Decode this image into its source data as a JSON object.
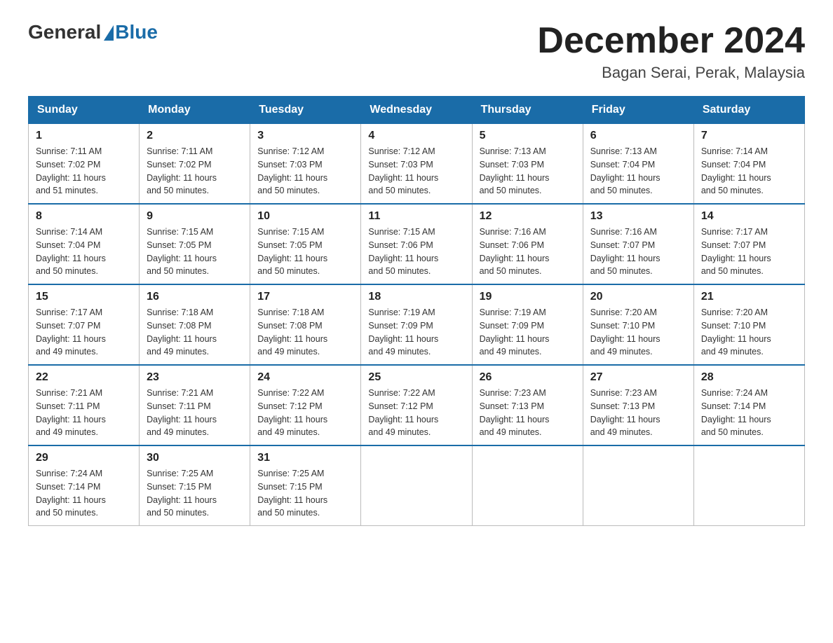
{
  "header": {
    "logo_general": "General",
    "logo_blue": "Blue",
    "month_title": "December 2024",
    "location": "Bagan Serai, Perak, Malaysia"
  },
  "days_of_week": [
    "Sunday",
    "Monday",
    "Tuesday",
    "Wednesday",
    "Thursday",
    "Friday",
    "Saturday"
  ],
  "weeks": [
    [
      {
        "day": "1",
        "sunrise": "7:11 AM",
        "sunset": "7:02 PM",
        "daylight": "11 hours and 51 minutes."
      },
      {
        "day": "2",
        "sunrise": "7:11 AM",
        "sunset": "7:02 PM",
        "daylight": "11 hours and 50 minutes."
      },
      {
        "day": "3",
        "sunrise": "7:12 AM",
        "sunset": "7:03 PM",
        "daylight": "11 hours and 50 minutes."
      },
      {
        "day": "4",
        "sunrise": "7:12 AM",
        "sunset": "7:03 PM",
        "daylight": "11 hours and 50 minutes."
      },
      {
        "day": "5",
        "sunrise": "7:13 AM",
        "sunset": "7:03 PM",
        "daylight": "11 hours and 50 minutes."
      },
      {
        "day": "6",
        "sunrise": "7:13 AM",
        "sunset": "7:04 PM",
        "daylight": "11 hours and 50 minutes."
      },
      {
        "day": "7",
        "sunrise": "7:14 AM",
        "sunset": "7:04 PM",
        "daylight": "11 hours and 50 minutes."
      }
    ],
    [
      {
        "day": "8",
        "sunrise": "7:14 AM",
        "sunset": "7:04 PM",
        "daylight": "11 hours and 50 minutes."
      },
      {
        "day": "9",
        "sunrise": "7:15 AM",
        "sunset": "7:05 PM",
        "daylight": "11 hours and 50 minutes."
      },
      {
        "day": "10",
        "sunrise": "7:15 AM",
        "sunset": "7:05 PM",
        "daylight": "11 hours and 50 minutes."
      },
      {
        "day": "11",
        "sunrise": "7:15 AM",
        "sunset": "7:06 PM",
        "daylight": "11 hours and 50 minutes."
      },
      {
        "day": "12",
        "sunrise": "7:16 AM",
        "sunset": "7:06 PM",
        "daylight": "11 hours and 50 minutes."
      },
      {
        "day": "13",
        "sunrise": "7:16 AM",
        "sunset": "7:07 PM",
        "daylight": "11 hours and 50 minutes."
      },
      {
        "day": "14",
        "sunrise": "7:17 AM",
        "sunset": "7:07 PM",
        "daylight": "11 hours and 50 minutes."
      }
    ],
    [
      {
        "day": "15",
        "sunrise": "7:17 AM",
        "sunset": "7:07 PM",
        "daylight": "11 hours and 49 minutes."
      },
      {
        "day": "16",
        "sunrise": "7:18 AM",
        "sunset": "7:08 PM",
        "daylight": "11 hours and 49 minutes."
      },
      {
        "day": "17",
        "sunrise": "7:18 AM",
        "sunset": "7:08 PM",
        "daylight": "11 hours and 49 minutes."
      },
      {
        "day": "18",
        "sunrise": "7:19 AM",
        "sunset": "7:09 PM",
        "daylight": "11 hours and 49 minutes."
      },
      {
        "day": "19",
        "sunrise": "7:19 AM",
        "sunset": "7:09 PM",
        "daylight": "11 hours and 49 minutes."
      },
      {
        "day": "20",
        "sunrise": "7:20 AM",
        "sunset": "7:10 PM",
        "daylight": "11 hours and 49 minutes."
      },
      {
        "day": "21",
        "sunrise": "7:20 AM",
        "sunset": "7:10 PM",
        "daylight": "11 hours and 49 minutes."
      }
    ],
    [
      {
        "day": "22",
        "sunrise": "7:21 AM",
        "sunset": "7:11 PM",
        "daylight": "11 hours and 49 minutes."
      },
      {
        "day": "23",
        "sunrise": "7:21 AM",
        "sunset": "7:11 PM",
        "daylight": "11 hours and 49 minutes."
      },
      {
        "day": "24",
        "sunrise": "7:22 AM",
        "sunset": "7:12 PM",
        "daylight": "11 hours and 49 minutes."
      },
      {
        "day": "25",
        "sunrise": "7:22 AM",
        "sunset": "7:12 PM",
        "daylight": "11 hours and 49 minutes."
      },
      {
        "day": "26",
        "sunrise": "7:23 AM",
        "sunset": "7:13 PM",
        "daylight": "11 hours and 49 minutes."
      },
      {
        "day": "27",
        "sunrise": "7:23 AM",
        "sunset": "7:13 PM",
        "daylight": "11 hours and 49 minutes."
      },
      {
        "day": "28",
        "sunrise": "7:24 AM",
        "sunset": "7:14 PM",
        "daylight": "11 hours and 50 minutes."
      }
    ],
    [
      {
        "day": "29",
        "sunrise": "7:24 AM",
        "sunset": "7:14 PM",
        "daylight": "11 hours and 50 minutes."
      },
      {
        "day": "30",
        "sunrise": "7:25 AM",
        "sunset": "7:15 PM",
        "daylight": "11 hours and 50 minutes."
      },
      {
        "day": "31",
        "sunrise": "7:25 AM",
        "sunset": "7:15 PM",
        "daylight": "11 hours and 50 minutes."
      },
      null,
      null,
      null,
      null
    ]
  ],
  "labels": {
    "sunrise": "Sunrise:",
    "sunset": "Sunset:",
    "daylight": "Daylight:"
  }
}
